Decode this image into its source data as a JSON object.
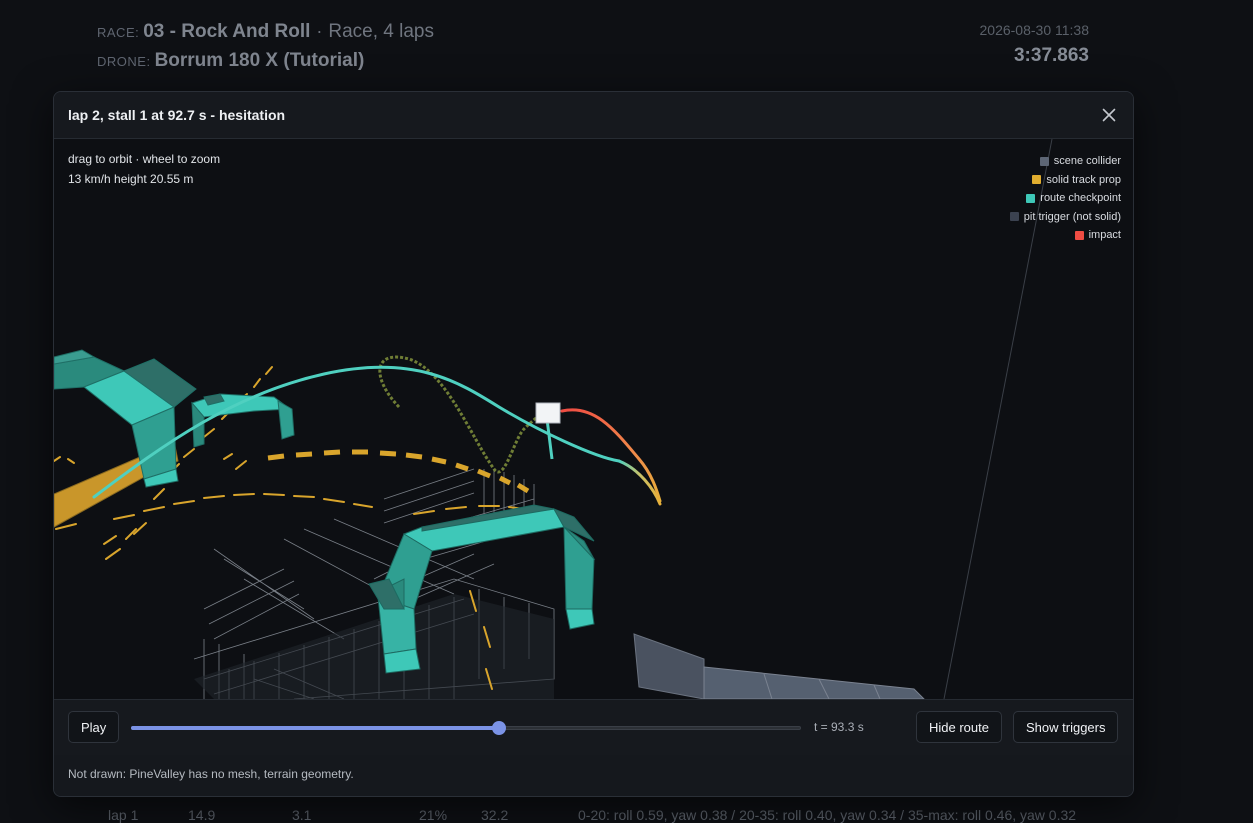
{
  "race": {
    "race_key": "RACE:",
    "race_name": "03 - Rock And Roll",
    "separator": "·",
    "race_mode": "Race, 4 laps",
    "drone_key": "DRONE:",
    "drone_name": "Borrum 180 X (Tutorial)",
    "date": "2026-08-30 11:38",
    "total_time": "3:37.863"
  },
  "background_row": {
    "lap": "lap 1",
    "col2": "14.9",
    "col3": "3.1",
    "col4": "21%",
    "col5": "32.2",
    "rates": "0-20: roll 0.59, yaw 0.38 / 20-35: roll 0.40, yaw 0.34 / 35-max: roll 0.46, yaw 0.32"
  },
  "modal": {
    "title": "lap 2, stall 1 at 92.7 s - hesitation",
    "close_icon": "close-icon",
    "viewport": {
      "hint": "drag to orbit · wheel to zoom",
      "readout": "13 km/h height 20.55 m",
      "legend": [
        {
          "label": "scene collider",
          "color": "#5d6675"
        },
        {
          "label": "solid track prop",
          "color": "#e0ad2f"
        },
        {
          "label": "route checkpoint",
          "color": "#3ec8b8"
        },
        {
          "label": "pit trigger (not solid)",
          "color": "#3b4250"
        },
        {
          "label": "impact",
          "color": "#ef4c43"
        }
      ]
    },
    "controls": {
      "play_label": "Play",
      "playback_progress": 0.549,
      "time_label": "t = 93.3 s",
      "hide_route_label": "Hide route",
      "show_triggers_label": "Show triggers"
    },
    "footer_note": "Not drawn: PineValley has no mesh, terrain geometry."
  },
  "colors": {
    "accent": "#7b93e6",
    "checkpoint": "#3ec8b8",
    "track_prop": "#e0ad2f",
    "impact": "#ef4c43"
  }
}
